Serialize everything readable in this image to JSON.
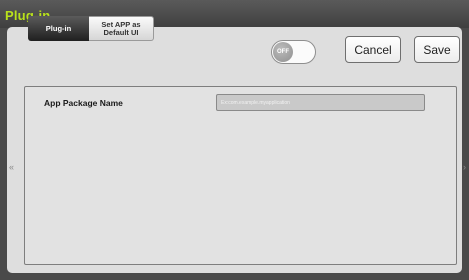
{
  "window": {
    "title": "Plug-in"
  },
  "tabs": [
    {
      "label": "Plug-in",
      "selected": true
    },
    {
      "label": "Set APP as Default UI",
      "selected": false
    }
  ],
  "toggle": {
    "label": "OFF",
    "state": "off"
  },
  "actions": {
    "cancel_label": "Cancel",
    "save_label": "Save"
  },
  "form": {
    "app_package_name_label": "App Package Name",
    "app_package_name_value": "",
    "app_package_name_placeholder": "Ex:com.example.myapplication"
  },
  "nav": {
    "prev_icon": "chevron-double-left-icon",
    "next_icon": "chevron-right-icon"
  },
  "colors": {
    "title": "#b9e21b",
    "titlebar": "#4a4a4a",
    "tab_selected": "#2a2a2a"
  }
}
